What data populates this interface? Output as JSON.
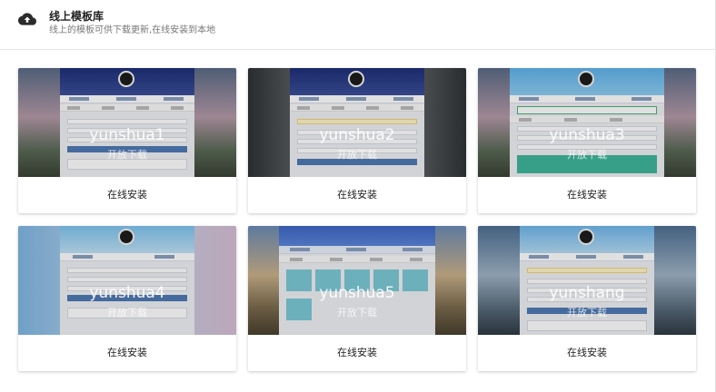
{
  "header": {
    "icon": "cloud-upload-icon",
    "title": "线上模板库",
    "subtitle": "线上的模板可供下载更新,在线安装到本地"
  },
  "templates": [
    {
      "name": "yunshua1",
      "status": "开放下载",
      "action": "在线安装"
    },
    {
      "name": "yunshua2",
      "status": "开放下载",
      "action": "在线安装"
    },
    {
      "name": "yunshua3",
      "status": "开放下载",
      "action": "在线安装"
    },
    {
      "name": "yunshua4",
      "status": "开放下载",
      "action": "在线安装"
    },
    {
      "name": "yunshua5",
      "status": "开放下载",
      "action": "在线安装"
    },
    {
      "name": "yunshang",
      "status": "开放下载",
      "action": "在线安装"
    }
  ],
  "colors": {
    "accent_blue": "#4f79b3",
    "text_dark": "#222222",
    "text_muted": "#777777"
  }
}
